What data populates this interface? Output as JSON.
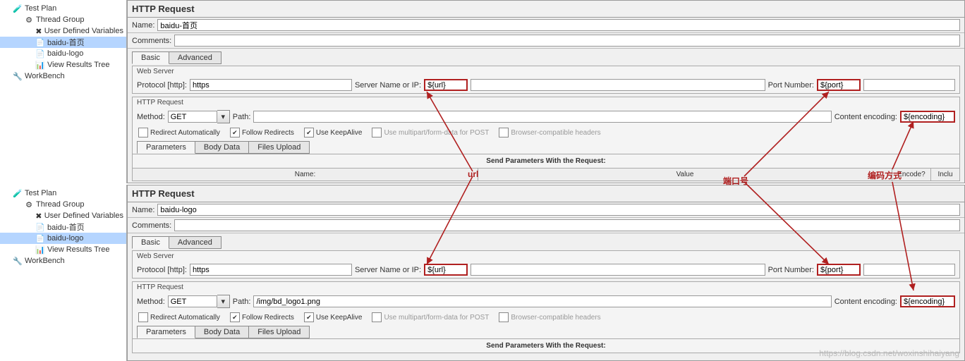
{
  "tree1": {
    "testPlan": "Test Plan",
    "threadGroup": "Thread Group",
    "udv": "User Defined Variables",
    "req1": "baidu-首页",
    "req2": "baidu-logo",
    "viewResults": "View Results Tree",
    "workbench": "WorkBench"
  },
  "tree2": {
    "testPlan": "Test Plan",
    "threadGroup": "Thread Group",
    "udv": "User Defined Variables",
    "req1": "baidu-首页",
    "req2": "baidu-logo",
    "viewResults": "View Results Tree",
    "workbench": "WorkBench"
  },
  "panel1": {
    "title": "HTTP Request",
    "nameLabel": "Name:",
    "nameValue": "baidu-首页",
    "commentsLabel": "Comments:",
    "commentsValue": "",
    "tabBasic": "Basic",
    "tabAdvanced": "Advanced",
    "webServer": "Web Server",
    "protocolLabel": "Protocol [http]:",
    "protocolValue": "https",
    "serverLabel": "Server Name or IP:",
    "serverValue": "${url}",
    "portLabel": "Port Number:",
    "portValue": "${port}",
    "httpReq": "HTTP Request",
    "methodLabel": "Method:",
    "methodValue": "GET",
    "pathLabel": "Path:",
    "pathValue": "",
    "encodingLabel": "Content encoding:",
    "encodingValue": "${encoding}",
    "cb": {
      "redirectAuto": "Redirect Automatically",
      "followRedirects": "Follow Redirects",
      "keepAlive": "Use KeepAlive",
      "multipart": "Use multipart/form-data for POST",
      "browserHeaders": "Browser-compatible headers"
    },
    "tabsParams": "Parameters",
    "tabsBody": "Body Data",
    "tabsFiles": "Files Upload",
    "sendParams": "Send Parameters With the Request:",
    "thName": "Name:",
    "thValue": "Value",
    "thEncode": "Encode?",
    "thInclude": "Inclu"
  },
  "panel2": {
    "title": "HTTP Request",
    "nameLabel": "Name:",
    "nameValue": "baidu-logo",
    "commentsLabel": "Comments:",
    "commentsValue": "",
    "tabBasic": "Basic",
    "tabAdvanced": "Advanced",
    "webServer": "Web Server",
    "protocolLabel": "Protocol [http]:",
    "protocolValue": "https",
    "serverLabel": "Server Name or IP:",
    "serverValue": "${url}",
    "portLabel": "Port Number:",
    "portValue": "${port}",
    "httpReq": "HTTP Request",
    "methodLabel": "Method:",
    "methodValue": "GET",
    "pathLabel": "Path:",
    "pathValue": "/img/bd_logo1.png",
    "encodingLabel": "Content encoding:",
    "encodingValue": "${encoding}",
    "cb": {
      "redirectAuto": "Redirect Automatically",
      "followRedirects": "Follow Redirects",
      "keepAlive": "Use KeepAlive",
      "multipart": "Use multipart/form-data for POST",
      "browserHeaders": "Browser-compatible headers"
    },
    "tabsParams": "Parameters",
    "tabsBody": "Body Data",
    "tabsFiles": "Files Upload",
    "sendParams": "Send Parameters With the Request:"
  },
  "annotations": {
    "url": "url",
    "port": "端口号",
    "encoding": "编码方式"
  },
  "watermark": "https://blog.csdn.net/woxinshihaiyang"
}
